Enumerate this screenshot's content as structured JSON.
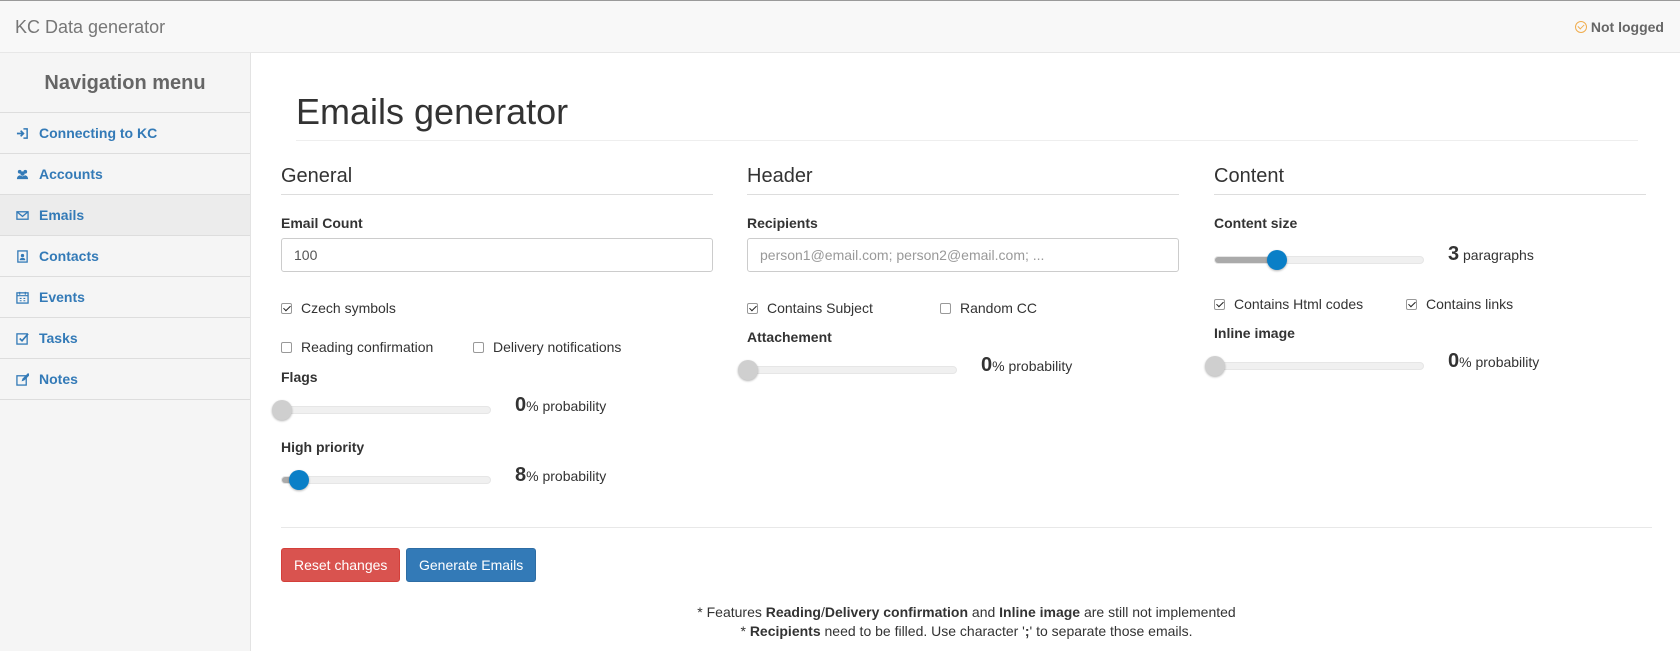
{
  "app": {
    "title": "KC Data generator",
    "login_status": "Not logged"
  },
  "sidebar": {
    "title": "Navigation menu",
    "items": [
      {
        "label": "Connecting to KC",
        "icon": "sign-in-icon"
      },
      {
        "label": "Accounts",
        "icon": "users-icon"
      },
      {
        "label": "Emails",
        "icon": "envelope-icon",
        "active": true
      },
      {
        "label": "Contacts",
        "icon": "address-book-icon"
      },
      {
        "label": "Events",
        "icon": "calendar-icon"
      },
      {
        "label": "Tasks",
        "icon": "check-square-icon"
      },
      {
        "label": "Notes",
        "icon": "edit-icon"
      }
    ]
  },
  "page": {
    "title": "Emails generator"
  },
  "general": {
    "heading": "General",
    "email_count_label": "Email Count",
    "email_count_value": "100",
    "czech_symbols": {
      "label": "Czech symbols",
      "checked": true
    },
    "reading_confirmation": {
      "label": "Reading confirmation",
      "checked": false
    },
    "delivery_notifications": {
      "label": "Delivery notifications",
      "checked": false
    },
    "flags": {
      "label": "Flags",
      "value": "0",
      "unit": "% probability",
      "fraction": 0
    },
    "high_priority": {
      "label": "High priority",
      "value": "8",
      "unit": "% probability",
      "fraction": 0.08
    }
  },
  "header": {
    "heading": "Header",
    "recipients_label": "Recipients",
    "recipients_placeholder": "person1@email.com; person2@email.com; ...",
    "contains_subject": {
      "label": "Contains Subject",
      "checked": true
    },
    "random_cc": {
      "label": "Random CC",
      "checked": false
    },
    "attachement": {
      "label": "Attachement",
      "value": "0",
      "unit": "% probability",
      "fraction": 0
    }
  },
  "content": {
    "heading": "Content",
    "content_size": {
      "label": "Content size",
      "value": "3",
      "unit": "paragraphs",
      "fraction": 0.3
    },
    "contains_html": {
      "label": "Contains Html codes",
      "checked": true
    },
    "contains_links": {
      "label": "Contains links",
      "checked": true
    },
    "inline_image": {
      "label": "Inline image",
      "value": "0",
      "unit": "% probability",
      "fraction": 0
    }
  },
  "actions": {
    "reset_label": "Reset changes",
    "generate_label": "Generate Emails"
  },
  "notes": {
    "line1": {
      "prefix": "* Features ",
      "b1": "Reading",
      "sep": "/",
      "b2": "Delivery confirmation",
      "mid": " and ",
      "b3": "Inline image",
      "suffix": " are still not implemented"
    },
    "line2": {
      "prefix": "* ",
      "b1": "Recipients",
      "mid": " need to be filled. Use character '",
      "b2": ";",
      "suffix": "' to separate those emails."
    }
  },
  "colors": {
    "accent": "#337ab7",
    "slider_thumb": "#0a7fc7",
    "danger": "#d9534f",
    "warning": "#f0ad4e"
  }
}
